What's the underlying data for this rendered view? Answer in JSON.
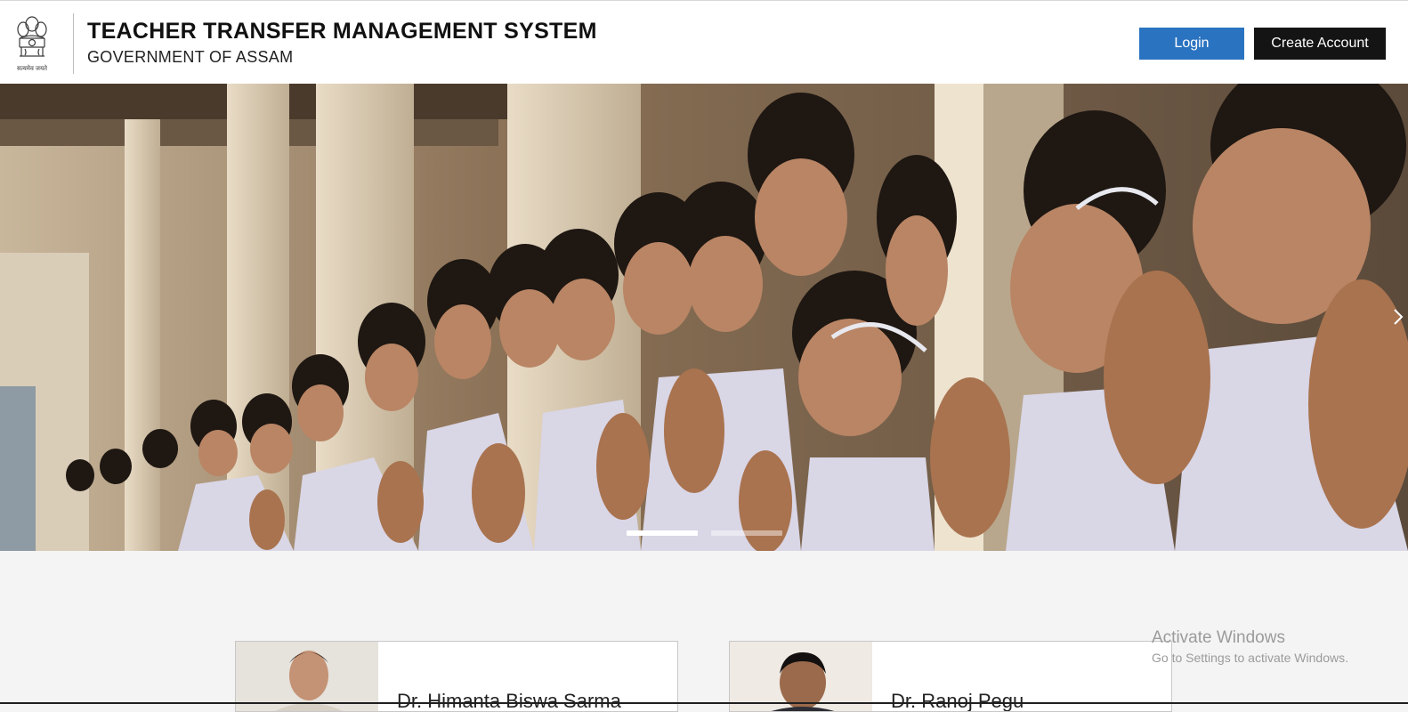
{
  "header": {
    "title": "TEACHER TRANSFER MANAGEMENT SYSTEM",
    "subtitle": "GOVERNMENT OF ASSAM",
    "emblem_motto": "सत्यमेव जयते",
    "login_label": "Login",
    "create_account_label": "Create Account",
    "login_color": "#2a73c0",
    "create_account_color": "#141414"
  },
  "carousel": {
    "slide_count": 2,
    "active_slide": 1,
    "next_icon": "chevron-right-icon"
  },
  "profiles": [
    {
      "name": "Dr. Himanta Biswa Sarma"
    },
    {
      "name": "Dr. Ranoj Pegu"
    }
  ],
  "windows_watermark": {
    "title": "Activate Windows",
    "subtitle": "Go to Settings to activate Windows."
  }
}
